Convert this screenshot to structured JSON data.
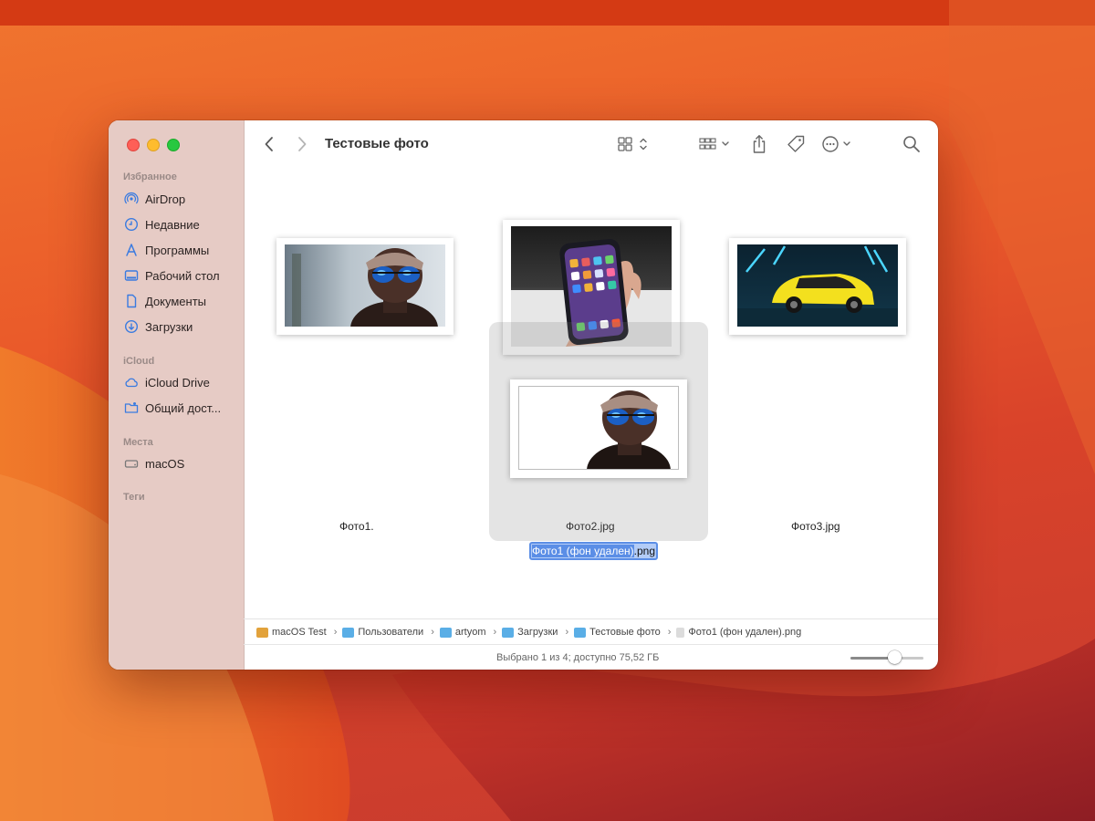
{
  "window": {
    "title": "Тестовые фото"
  },
  "sidebar": {
    "sections": [
      {
        "title": "Избранное",
        "items": [
          {
            "label": "AirDrop",
            "icon": "airdrop-icon"
          },
          {
            "label": "Недавние",
            "icon": "clock-icon"
          },
          {
            "label": "Программы",
            "icon": "applications-icon"
          },
          {
            "label": "Рабочий стол",
            "icon": "desktop-icon"
          },
          {
            "label": "Документы",
            "icon": "document-icon"
          },
          {
            "label": "Загрузки",
            "icon": "downloads-icon"
          }
        ]
      },
      {
        "title": "iCloud",
        "items": [
          {
            "label": "iCloud Drive",
            "icon": "cloud-icon"
          },
          {
            "label": "Общий дост...",
            "icon": "shared-folder-icon"
          }
        ]
      },
      {
        "title": "Места",
        "items": [
          {
            "label": "macOS",
            "icon": "disk-icon"
          }
        ]
      },
      {
        "title": "Теги",
        "items": []
      }
    ]
  },
  "files": [
    {
      "name": "Фото1.",
      "description": "man with sunglasses"
    },
    {
      "name": "Фото2.jpg",
      "description": "hand holding smartphone"
    },
    {
      "name": "Фото3.jpg",
      "description": "yellow car"
    }
  ],
  "selected_file": {
    "name_highlight": "Фото1 (фон удален)",
    "name_ext": ".png"
  },
  "pathbar": [
    {
      "label": "macOS Test",
      "color": "#e2a23b"
    },
    {
      "label": "Пользователи",
      "color": "#5aaee6"
    },
    {
      "label": "artyom",
      "color": "#5aaee6"
    },
    {
      "label": "Загрузки",
      "color": "#5aaee6"
    },
    {
      "label": "Тестовые фото",
      "color": "#5aaee6"
    },
    {
      "label": "Фото1 (фон удален).png",
      "color": "#d7d7d7"
    }
  ],
  "status": {
    "text": "Выбрано 1 из 4; доступно 75,52 ГБ",
    "zoom_fraction": 0.6
  }
}
